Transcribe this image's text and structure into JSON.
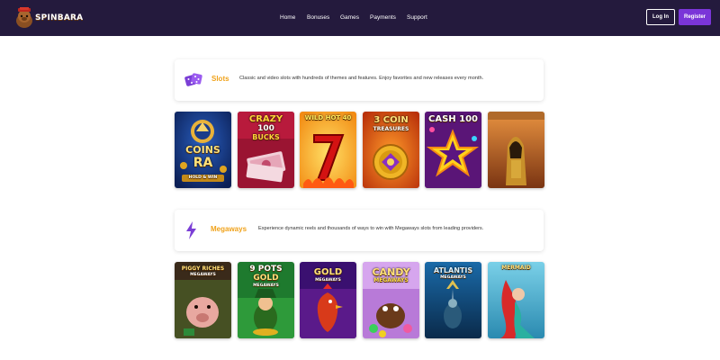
{
  "brand": {
    "name": "SPINBARA"
  },
  "nav": {
    "items": [
      "Home",
      "Bonuses",
      "Games",
      "Payments",
      "Support"
    ]
  },
  "auth": {
    "login_label": "Log In",
    "register_label": "Register"
  },
  "colors": {
    "header_bg": "#241a3d",
    "accent_purple": "#7a35d8",
    "title_orange": "#f0a21a"
  },
  "sections": [
    {
      "title": "Slots",
      "icon": "dice-icon",
      "description": "Classic and video slots with hundreds of themes and features. Enjoy favorites and new releases every month.",
      "games": [
        {
          "l1": "COINS",
          "l2": "RA",
          "l3": "HOLD & WIN"
        },
        {
          "l1": "CRAZY",
          "l2": "100",
          "l3": "BUCKS"
        },
        {
          "l1": "WILD HOT 40"
        },
        {
          "l1": "3 COIN",
          "l2": "TREASURES"
        },
        {
          "l1": "CASH 100"
        },
        {
          "l1": ""
        }
      ]
    },
    {
      "title": "Megaways",
      "icon": "lightning-icon",
      "description": "Experience dynamic reels and thousands of ways to win with Megaways slots from leading providers.",
      "games": [
        {
          "l1": "PIGGY RICHES",
          "l2": "MEGAWAYS"
        },
        {
          "l1": "9 POTS",
          "l2": "GOLD",
          "l3": "MEGAWAYS"
        },
        {
          "l1": "GOLD",
          "l2": "MEGAWAYS"
        },
        {
          "l1": "CANDY",
          "l2": "MEGAWAYS"
        },
        {
          "l1": "ATLANTIS",
          "l2": "MEGAWAYS"
        },
        {
          "l1": "MERMAID"
        }
      ]
    }
  ]
}
